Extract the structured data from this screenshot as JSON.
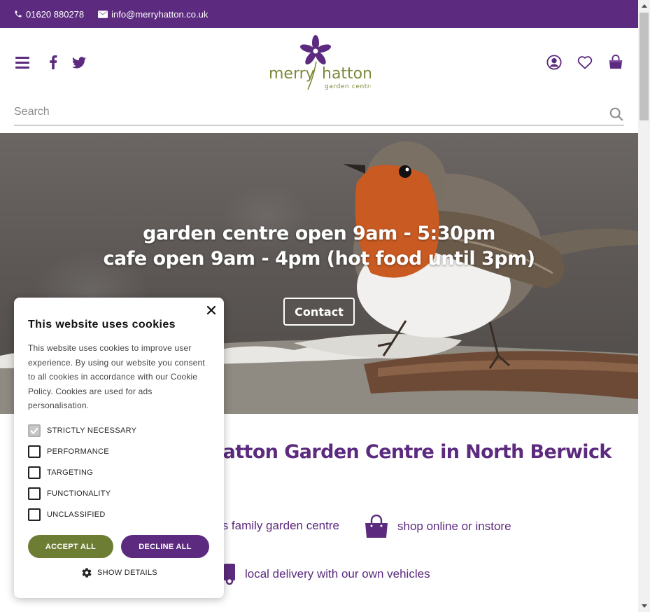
{
  "colors": {
    "brand_purple": "#5c2a7e",
    "accept_green": "#6e7d34",
    "logo_green": "#7a8a3a"
  },
  "topbar": {
    "phone": "01620 880278",
    "email": "info@merryhatton.co.uk"
  },
  "header": {
    "icons": [
      "menu-icon",
      "facebook-icon",
      "twitter-icon",
      "account-icon",
      "heart-icon",
      "bag-icon"
    ],
    "logo": {
      "word_1": "merry",
      "word_2": "hatton",
      "tagline": "garden centre"
    }
  },
  "search": {
    "placeholder": "Search"
  },
  "hero": {
    "line_1": "garden centre open 9am - 5:30pm",
    "line_2": "cafe open 9am - 4pm (hot food until 3pm)",
    "contact_label": "Contact"
  },
  "content": {
    "headline": "hatton Garden Centre in North Berwick",
    "feature_family": "n's family garden centre",
    "feature_shop": "shop online or instore",
    "feature_delivery": "local delivery with our own vehicles"
  },
  "cookie": {
    "title": "This website uses cookies",
    "description": "This website uses cookies to improve user experience. By using our website you consent to all cookies in accordance with our Cookie Policy. Cookies are used for ads personalisation.",
    "options": [
      {
        "label": "STRICTLY NECESSARY",
        "checked": true
      },
      {
        "label": "PERFORMANCE",
        "checked": false
      },
      {
        "label": "TARGETING",
        "checked": false
      },
      {
        "label": "FUNCTIONALITY",
        "checked": false
      },
      {
        "label": "UNCLASSIFIED",
        "checked": false
      }
    ],
    "accept_label": "ACCEPT ALL",
    "decline_label": "DECLINE ALL",
    "details_label": "SHOW DETAILS"
  }
}
